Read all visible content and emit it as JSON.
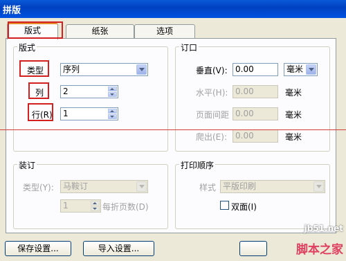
{
  "window": {
    "title": "拼版"
  },
  "tabs": [
    {
      "label": "版式"
    },
    {
      "label": "纸张"
    },
    {
      "label": "选项"
    }
  ],
  "layout_group": {
    "title": "版式",
    "type_label": "类型",
    "type_value": "序列",
    "columns_label": "列",
    "columns_value": "2",
    "rows_label": "行(R)",
    "rows_value": "1"
  },
  "margin_group": {
    "title": "订口",
    "vertical_label": "垂直(V):",
    "vertical_value": "0.00",
    "vertical_unit": "毫米",
    "horizontal_label": "水平(H):",
    "horizontal_value": "0.00",
    "horizontal_unit": "毫米",
    "page_spacing_label": "页面间距",
    "page_spacing_value": "0.00",
    "page_spacing_unit": "毫米",
    "bleed_label": "爬出(E):",
    "bleed_value": "0.00",
    "bleed_unit": "毫米"
  },
  "binding_group": {
    "title": "装订",
    "type_label": "类型(Y):",
    "type_value": "马鞍订",
    "pages_value": "1",
    "pages_label": "每折页数(D)"
  },
  "print_order_group": {
    "title": "打印顺序",
    "style_label": "样式",
    "style_value": "平版印刷",
    "duplex_label": "双面(I)",
    "duplex_checked": false
  },
  "buttons": {
    "save_settings": "保存设置...",
    "import_settings": "导入设置..."
  },
  "watermark": {
    "url": "jb51.net",
    "name": "脚本之家"
  }
}
